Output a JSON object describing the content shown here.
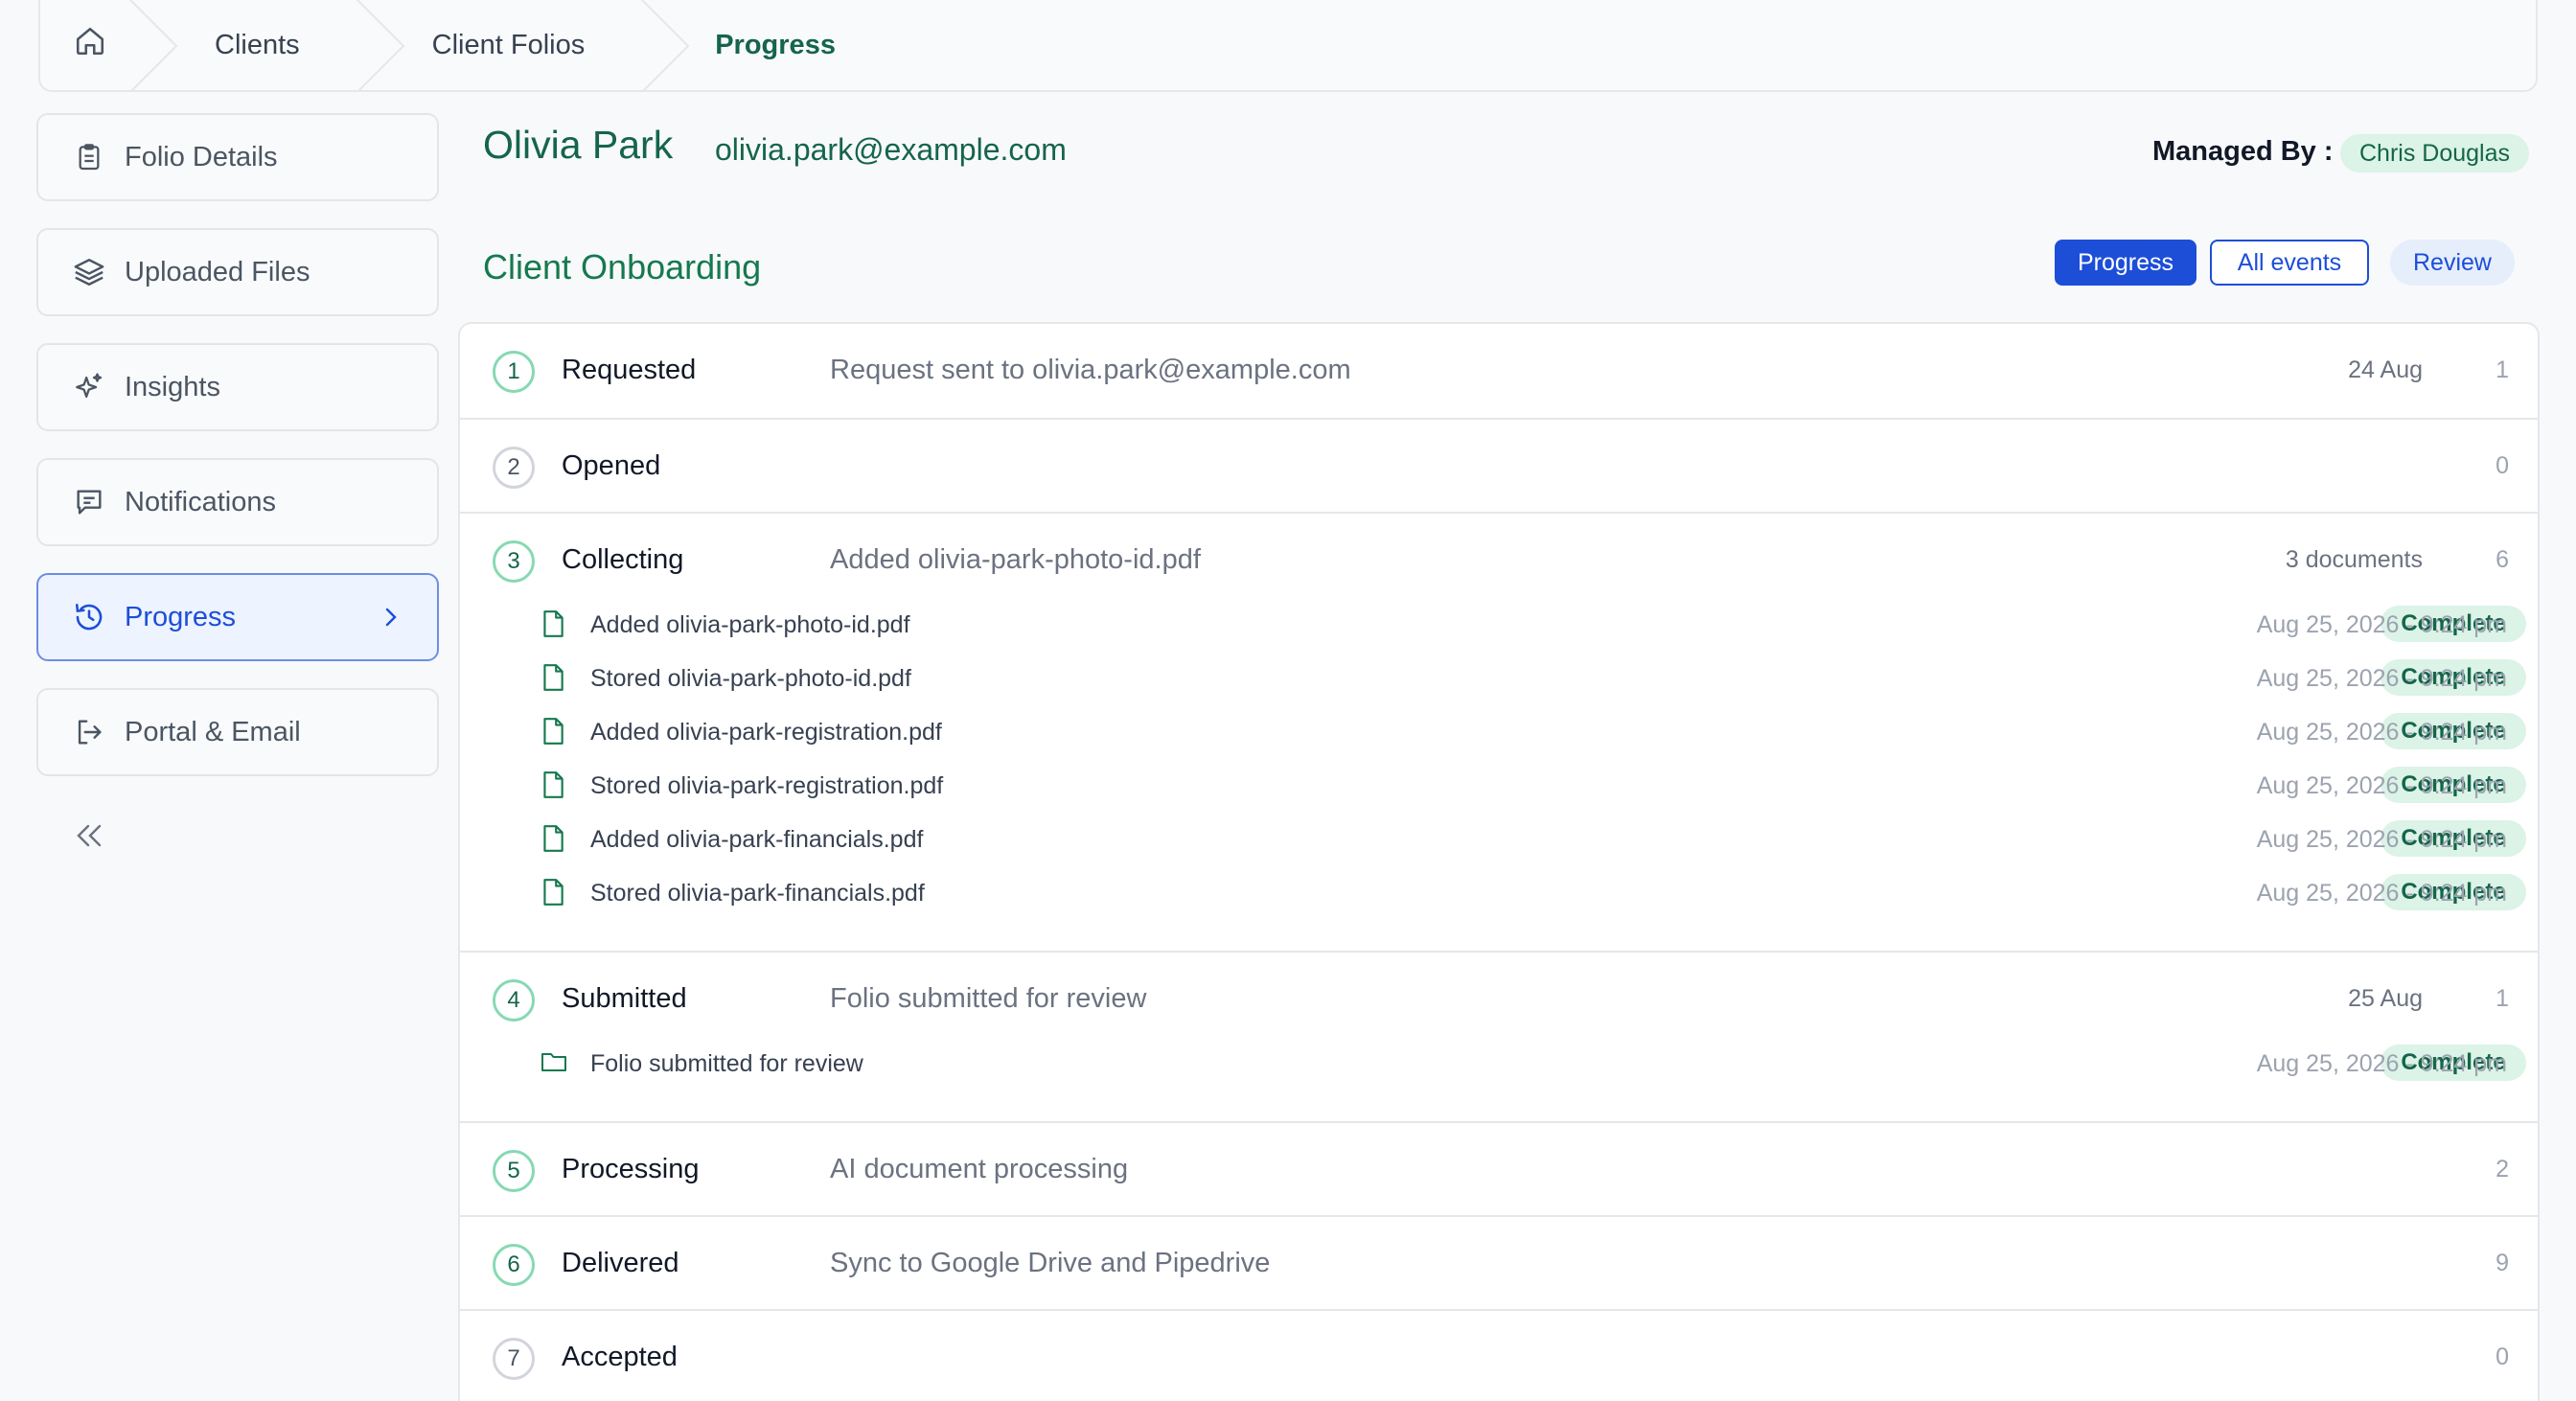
{
  "breadcrumb": {
    "home_icon": "home-icon",
    "items": [
      "Clients",
      "Client Folios",
      "Progress"
    ]
  },
  "sidebar": {
    "items": [
      {
        "label": "Folio Details",
        "icon": "clipboard-icon"
      },
      {
        "label": "Uploaded Files",
        "icon": "layers-icon"
      },
      {
        "label": "Insights",
        "icon": "sparkle-icon"
      },
      {
        "label": "Notifications",
        "icon": "message-icon"
      },
      {
        "label": "Progress",
        "icon": "history-icon",
        "active": true
      },
      {
        "label": "Portal & Email",
        "icon": "logout-icon"
      }
    ],
    "collapse_icon": "double-chevron-left-icon"
  },
  "client": {
    "name": "Olivia Park",
    "email": "olivia.park@example.com",
    "managed_label": "Managed By :",
    "manager": "Chris Douglas"
  },
  "section": {
    "title": "Client Onboarding",
    "tabs": {
      "progress": "Progress",
      "events": "All events",
      "review": "Review"
    }
  },
  "steps": [
    {
      "num": "1",
      "name": "Requested",
      "desc": "Request sent to olivia.park@example.com",
      "date": "24 Aug",
      "count": "1"
    },
    {
      "num": "2",
      "name": "Opened",
      "desc": "",
      "date": "",
      "count": "0"
    },
    {
      "num": "3",
      "name": "Collecting",
      "desc": "Added olivia-park-photo-id.pdf",
      "date": "3 documents",
      "count": "6",
      "events": [
        {
          "text": "Added olivia-park-photo-id.pdf",
          "status": "Complete",
          "time": "Aug 25, 2026 - 9:24 pm"
        },
        {
          "text": "Stored olivia-park-photo-id.pdf",
          "status": "Complete",
          "time": "Aug 25, 2026 - 9:24 pm"
        },
        {
          "text": "Added olivia-park-registration.pdf",
          "status": "Complete",
          "time": "Aug 25, 2026 - 9:24 pm"
        },
        {
          "text": "Stored olivia-park-registration.pdf",
          "status": "Complete",
          "time": "Aug 25, 2026 - 9:24 pm"
        },
        {
          "text": "Added olivia-park-financials.pdf",
          "status": "Complete",
          "time": "Aug 25, 2026 - 9:24 pm"
        },
        {
          "text": "Stored olivia-park-financials.pdf",
          "status": "Complete",
          "time": "Aug 25, 2026 - 9:24 pm"
        }
      ]
    },
    {
      "num": "4",
      "name": "Submitted",
      "desc": "Folio submitted for review",
      "date": "25 Aug",
      "count": "1",
      "events": [
        {
          "text": "Folio submitted for review",
          "status": "Complete",
          "time": "Aug 25, 2026 - 9:24 pm"
        }
      ]
    },
    {
      "num": "5",
      "name": "Processing",
      "desc": "AI document processing",
      "date": "",
      "count": "2"
    },
    {
      "num": "6",
      "name": "Delivered",
      "desc": "Sync to Google Drive and Pipedrive",
      "date": "",
      "count": "9"
    },
    {
      "num": "7",
      "name": "Accepted",
      "desc": "",
      "date": "",
      "count": "0"
    }
  ],
  "colors": {
    "brand_green": "#15654a",
    "accent_blue": "#1d4ed8",
    "badge_bg": "#dcf3e7"
  }
}
